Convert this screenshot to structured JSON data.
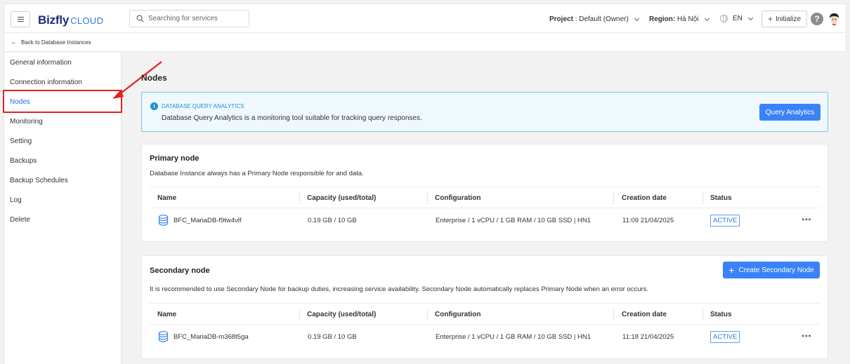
{
  "header": {
    "brand_main": "Bizfly",
    "brand_sub": "CLOUD",
    "search_placeholder": "Searching for services",
    "project_label": "Project",
    "project_value": ": Default (Owner)",
    "region_label": "Region:",
    "region_value": "Hà Nội",
    "language": "EN",
    "initialize_label": "Initialize",
    "help_label": "?"
  },
  "breadcrumb": {
    "back_label": "Back to Database Instances"
  },
  "sidebar": {
    "items": [
      {
        "label": "General information",
        "active": false
      },
      {
        "label": "Connection information",
        "active": false
      },
      {
        "label": "Nodes",
        "active": true
      },
      {
        "label": "Monitoring",
        "active": false
      },
      {
        "label": "Setting",
        "active": false
      },
      {
        "label": "Backups",
        "active": false
      },
      {
        "label": "Backup Schedules",
        "active": false
      },
      {
        "label": "Log",
        "active": false
      },
      {
        "label": "Delete",
        "active": false
      }
    ]
  },
  "main": {
    "title": "Nodes",
    "info": {
      "title": "DATABASE QUERY ANALYTICS",
      "description": "Database Query Analytics is a monitoring tool suitable for tracking query responses.",
      "button_label": "Query Analytics"
    },
    "columns": [
      "Name",
      "Capacity (used/total)",
      "Configuration",
      "Creation date",
      "Status"
    ],
    "primary": {
      "title": "Primary node",
      "description": "Database Instance always has a Primary Node responsible for and data.",
      "rows": [
        {
          "name": "BFC_MariaDB-f9tw4vlf",
          "capacity": "0.19 GB / 10 GB",
          "configuration": "Enterprise / 1 vCPU / 1 GB RAM / 10 GB SSD | HN1",
          "created": "11:09 21/04/2025",
          "status": "ACTIVE"
        }
      ]
    },
    "secondary": {
      "title": "Secondary node",
      "description": "It is recommended to use Secondary Node for backup duties, increasing service availability. Secondary Node automatically replaces Primary Node when an error occurs.",
      "button_label": "Create Secondary Node",
      "rows": [
        {
          "name": "BFC_MariaDB-m368t5ga",
          "capacity": "0.19 GB / 10 GB",
          "configuration": "Enterprise / 1 vCPU / 1 GB RAM / 10 GB SSD | HN1",
          "created": "11:18 21/04/2025",
          "status": "ACTIVE"
        }
      ]
    }
  },
  "colors": {
    "accent": "#3b82f6",
    "active_link": "#1f6fe0",
    "annotation_red": "#e52020",
    "info_bg": "#eef8fd"
  }
}
